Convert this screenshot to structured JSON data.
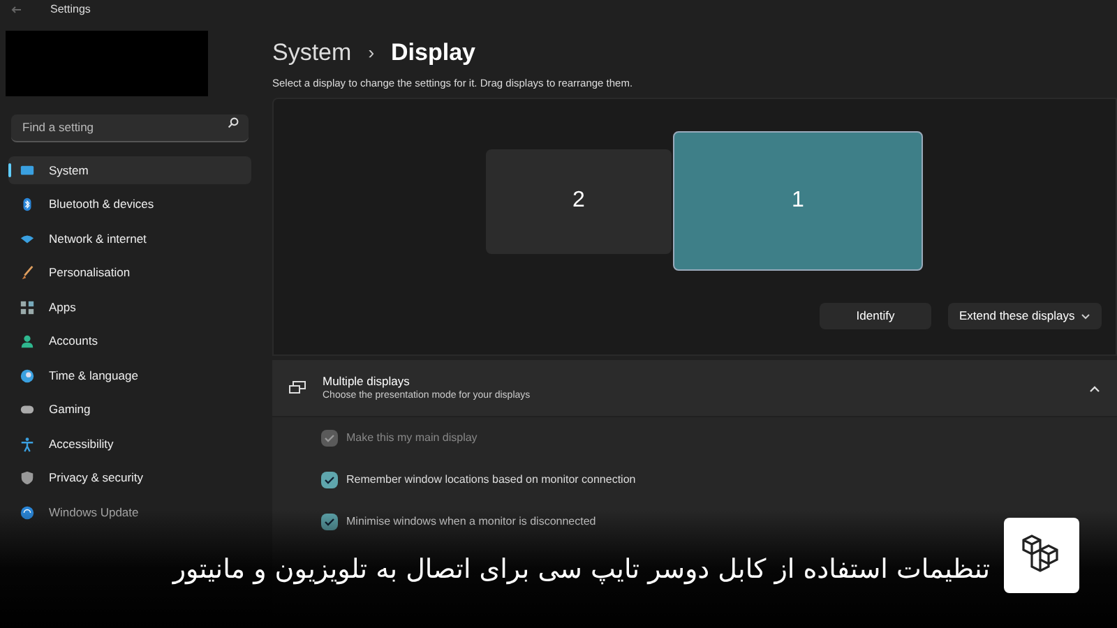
{
  "window": {
    "title": "Settings"
  },
  "search": {
    "placeholder": "Find a setting"
  },
  "nav": [
    {
      "label": "System",
      "selected": true
    },
    {
      "label": "Bluetooth & devices",
      "selected": false
    },
    {
      "label": "Network & internet",
      "selected": false
    },
    {
      "label": "Personalisation",
      "selected": false
    },
    {
      "label": "Apps",
      "selected": false
    },
    {
      "label": "Accounts",
      "selected": false
    },
    {
      "label": "Time & language",
      "selected": false
    },
    {
      "label": "Gaming",
      "selected": false
    },
    {
      "label": "Accessibility",
      "selected": false
    },
    {
      "label": "Privacy & security",
      "selected": false
    },
    {
      "label": "Windows Update",
      "selected": false
    }
  ],
  "breadcrumb": {
    "parent": "System",
    "separator": "›",
    "current": "Display"
  },
  "description": "Select a display to change the settings for it. Drag displays to rearrange them.",
  "displays": [
    {
      "label": "2",
      "selected": false
    },
    {
      "label": "1",
      "selected": true
    }
  ],
  "buttons": {
    "identify": "Identify",
    "mode": "Extend these displays"
  },
  "multiple_displays": {
    "title": "Multiple displays",
    "subtitle": "Choose the presentation mode for your displays",
    "expanded": true,
    "options": [
      {
        "label": "Make this my main display",
        "checked": true,
        "disabled": true
      },
      {
        "label": "Remember window locations based on monitor connection",
        "checked": true,
        "disabled": false
      },
      {
        "label": "Minimise windows when a monitor is disconnected",
        "checked": true,
        "disabled": false
      }
    ]
  },
  "caption": "تنظیمات استفاده از کابل دوسر تایپ سی برای اتصال به تلویزیون و مانیتور"
}
